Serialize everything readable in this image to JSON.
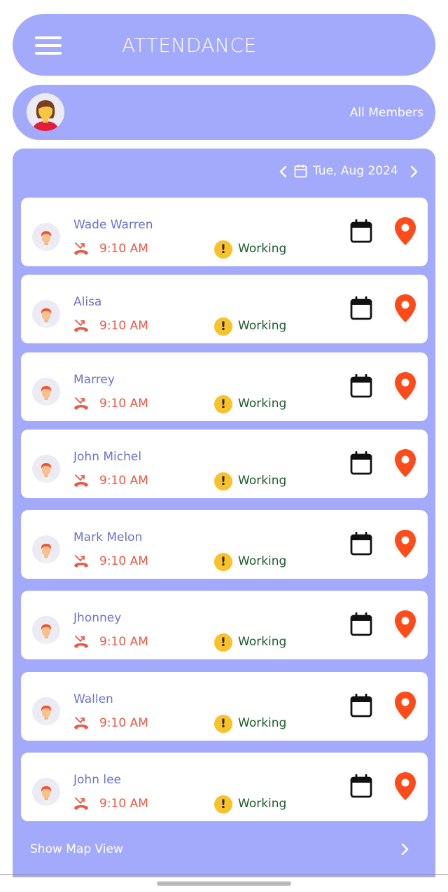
{
  "header": {
    "title": "ATTENDANCE",
    "menu_icon": "hamburger-menu-icon"
  },
  "members_bar": {
    "label": "All Members"
  },
  "date_nav": {
    "date": "Tue, Aug 2024"
  },
  "colors": {
    "accent": "#a3a9fb",
    "name": "#6b73c9",
    "time": "#e85a47",
    "status": "#1f5b2e",
    "warning": "#f8c22a",
    "pin": "#ff4a1a"
  },
  "members": [
    {
      "name": "Wade Warren",
      "time": "9:10 AM",
      "status": "Working"
    },
    {
      "name": "Alisa",
      "time": "9:10 AM",
      "status": "Working"
    },
    {
      "name": "Marrey",
      "time": "9:10 AM",
      "status": "Working"
    },
    {
      "name": "John Michel",
      "time": "9:10 AM",
      "status": "Working"
    },
    {
      "name": "Mark Melon",
      "time": "9:10 AM",
      "status": "Working"
    },
    {
      "name": "Jhonney",
      "time": "9:10 AM",
      "status": "Working"
    },
    {
      "name": "Wallen",
      "time": "9:10 AM",
      "status": "Working"
    },
    {
      "name": "John lee",
      "time": "9:10 AM",
      "status": "Working"
    }
  ],
  "footer": {
    "show_map_label": "Show Map View"
  }
}
